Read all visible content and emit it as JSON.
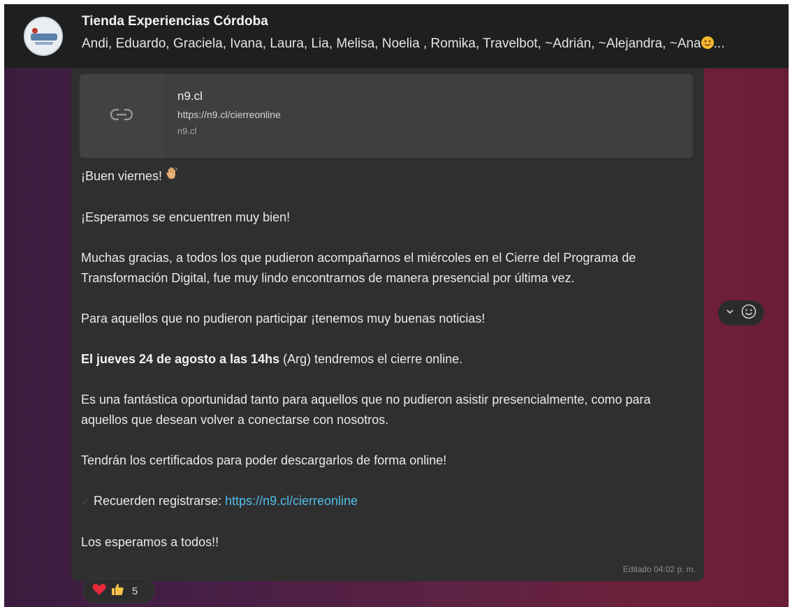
{
  "header": {
    "title": "Tienda Experiencias Córdoba",
    "participants": "Andi, Eduardo, Graciela, Ivana, Laura, Lia, Melisa, Noelia , Romika, Travelbot, ~Adrián, ~Alejandra, ~Ana",
    "participants_suffix": "...",
    "avatar_icon": "group-avatar"
  },
  "link_preview": {
    "title": "n9.cl",
    "url": "https://n9.cl/cierreonline",
    "domain": "n9.cl",
    "icon": "link-icon"
  },
  "message": {
    "greeting": "¡Buen viernes!",
    "greeting_emoji": "👋",
    "line2": "¡Esperamos se encuentren muy bien!",
    "line3": "Muchas gracias, a todos los que pudieron acompañarnos el miércoles en el Cierre del Programa de Transformación Digital, fue muy lindo encontrarnos de manera presencial por última vez.",
    "line4": "Para aquellos que no pudieron participar ¡tenemos muy buenas noticias!",
    "line5_bold": "El jueves 24 de agosto a las 14hs",
    "line5_rest": " (Arg) tendremos el cierre online.",
    "line6": "Es una fantástica oportunidad tanto para aquellos que no pudieron asistir presencialmente, como para aquellos que desean volver a conectarse con nosotros.",
    "line7": "Tendrán los certificados para poder descargarlos de forma online!",
    "line8_prefix": "Recuerden registrarse: ",
    "line8_link": "https://n9.cl/cierreonline",
    "line9": "Los esperamos a todos!!",
    "edited": "Editado 04:02 p. m."
  },
  "reactions": {
    "count": "5",
    "emojis": [
      "heart",
      "thumbs-up"
    ]
  },
  "colors": {
    "header_bg": "#1f1f1f",
    "bubble_bg": "#2f2f2f",
    "link_color": "#53bdeb"
  }
}
